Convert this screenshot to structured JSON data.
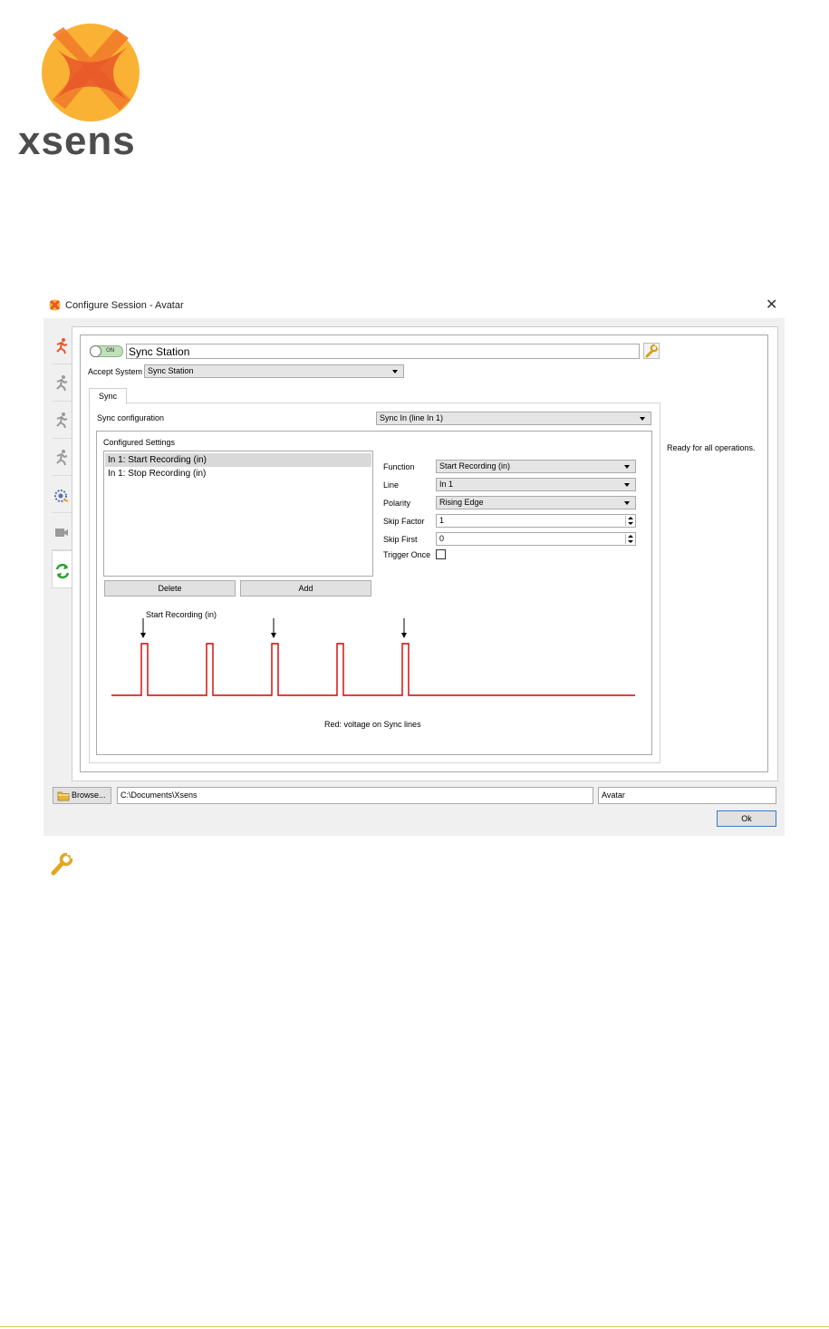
{
  "brand": {
    "logo_text": "xsens"
  },
  "window": {
    "title": "Configure Session - Avatar",
    "close_glyph": "✕"
  },
  "sidebar": {
    "items": [
      {
        "icon": "runner-icon",
        "color": "#e8562a"
      },
      {
        "icon": "runner-icon",
        "color": "#9a9a9a"
      },
      {
        "icon": "runner-icon",
        "color": "#9a9a9a"
      },
      {
        "icon": "runner-icon",
        "color": "#9a9a9a"
      },
      {
        "icon": "gear-runner-icon",
        "color": "#5a6fb0"
      },
      {
        "icon": "camera-icon",
        "color": "#9a9a9a"
      },
      {
        "icon": "sync-icon",
        "color": "#2aa02a",
        "active": true
      }
    ]
  },
  "device": {
    "toggle_label": "ON",
    "name_value": "Sync Station",
    "accept_label": "Accept System",
    "accept_value": "Sync Station"
  },
  "tabs": {
    "sync_label": "Sync"
  },
  "sync": {
    "config_label": "Sync configuration",
    "config_value": "Sync In (line In 1)",
    "settings_label": "Configured Settings",
    "list": [
      "In 1: Start Recording (in)",
      "In 1: Stop Recording (in)"
    ],
    "delete_label": "Delete",
    "add_label": "Add",
    "function_label": "Function",
    "function_value": "Start Recording (in)",
    "line_label": "Line",
    "line_value": "In 1",
    "polarity_label": "Polarity",
    "polarity_value": "Rising Edge",
    "skip_factor_label": "Skip Factor",
    "skip_factor_value": "1",
    "skip_first_label": "Skip First",
    "skip_first_value": "0",
    "trigger_once_label": "Trigger Once",
    "trigger_once_checked": false
  },
  "diagram": {
    "annotation": "Start Recording (in)",
    "caption": "Red: voltage on Sync lines",
    "pulse_count": 5,
    "arrow_pulses": [
      1,
      3,
      5
    ],
    "line_color": "#d40000"
  },
  "status": {
    "text": "Ready for all operations."
  },
  "footer": {
    "browse_label": "Browse...",
    "path_value": "C:\\Documents\\Xsens",
    "session_value": "Avatar",
    "ok_label": "Ok"
  },
  "colors": {
    "accent_orange": "#e8562a",
    "logo_yellow": "#f9b233",
    "focus_blue": "#3a78c4"
  }
}
